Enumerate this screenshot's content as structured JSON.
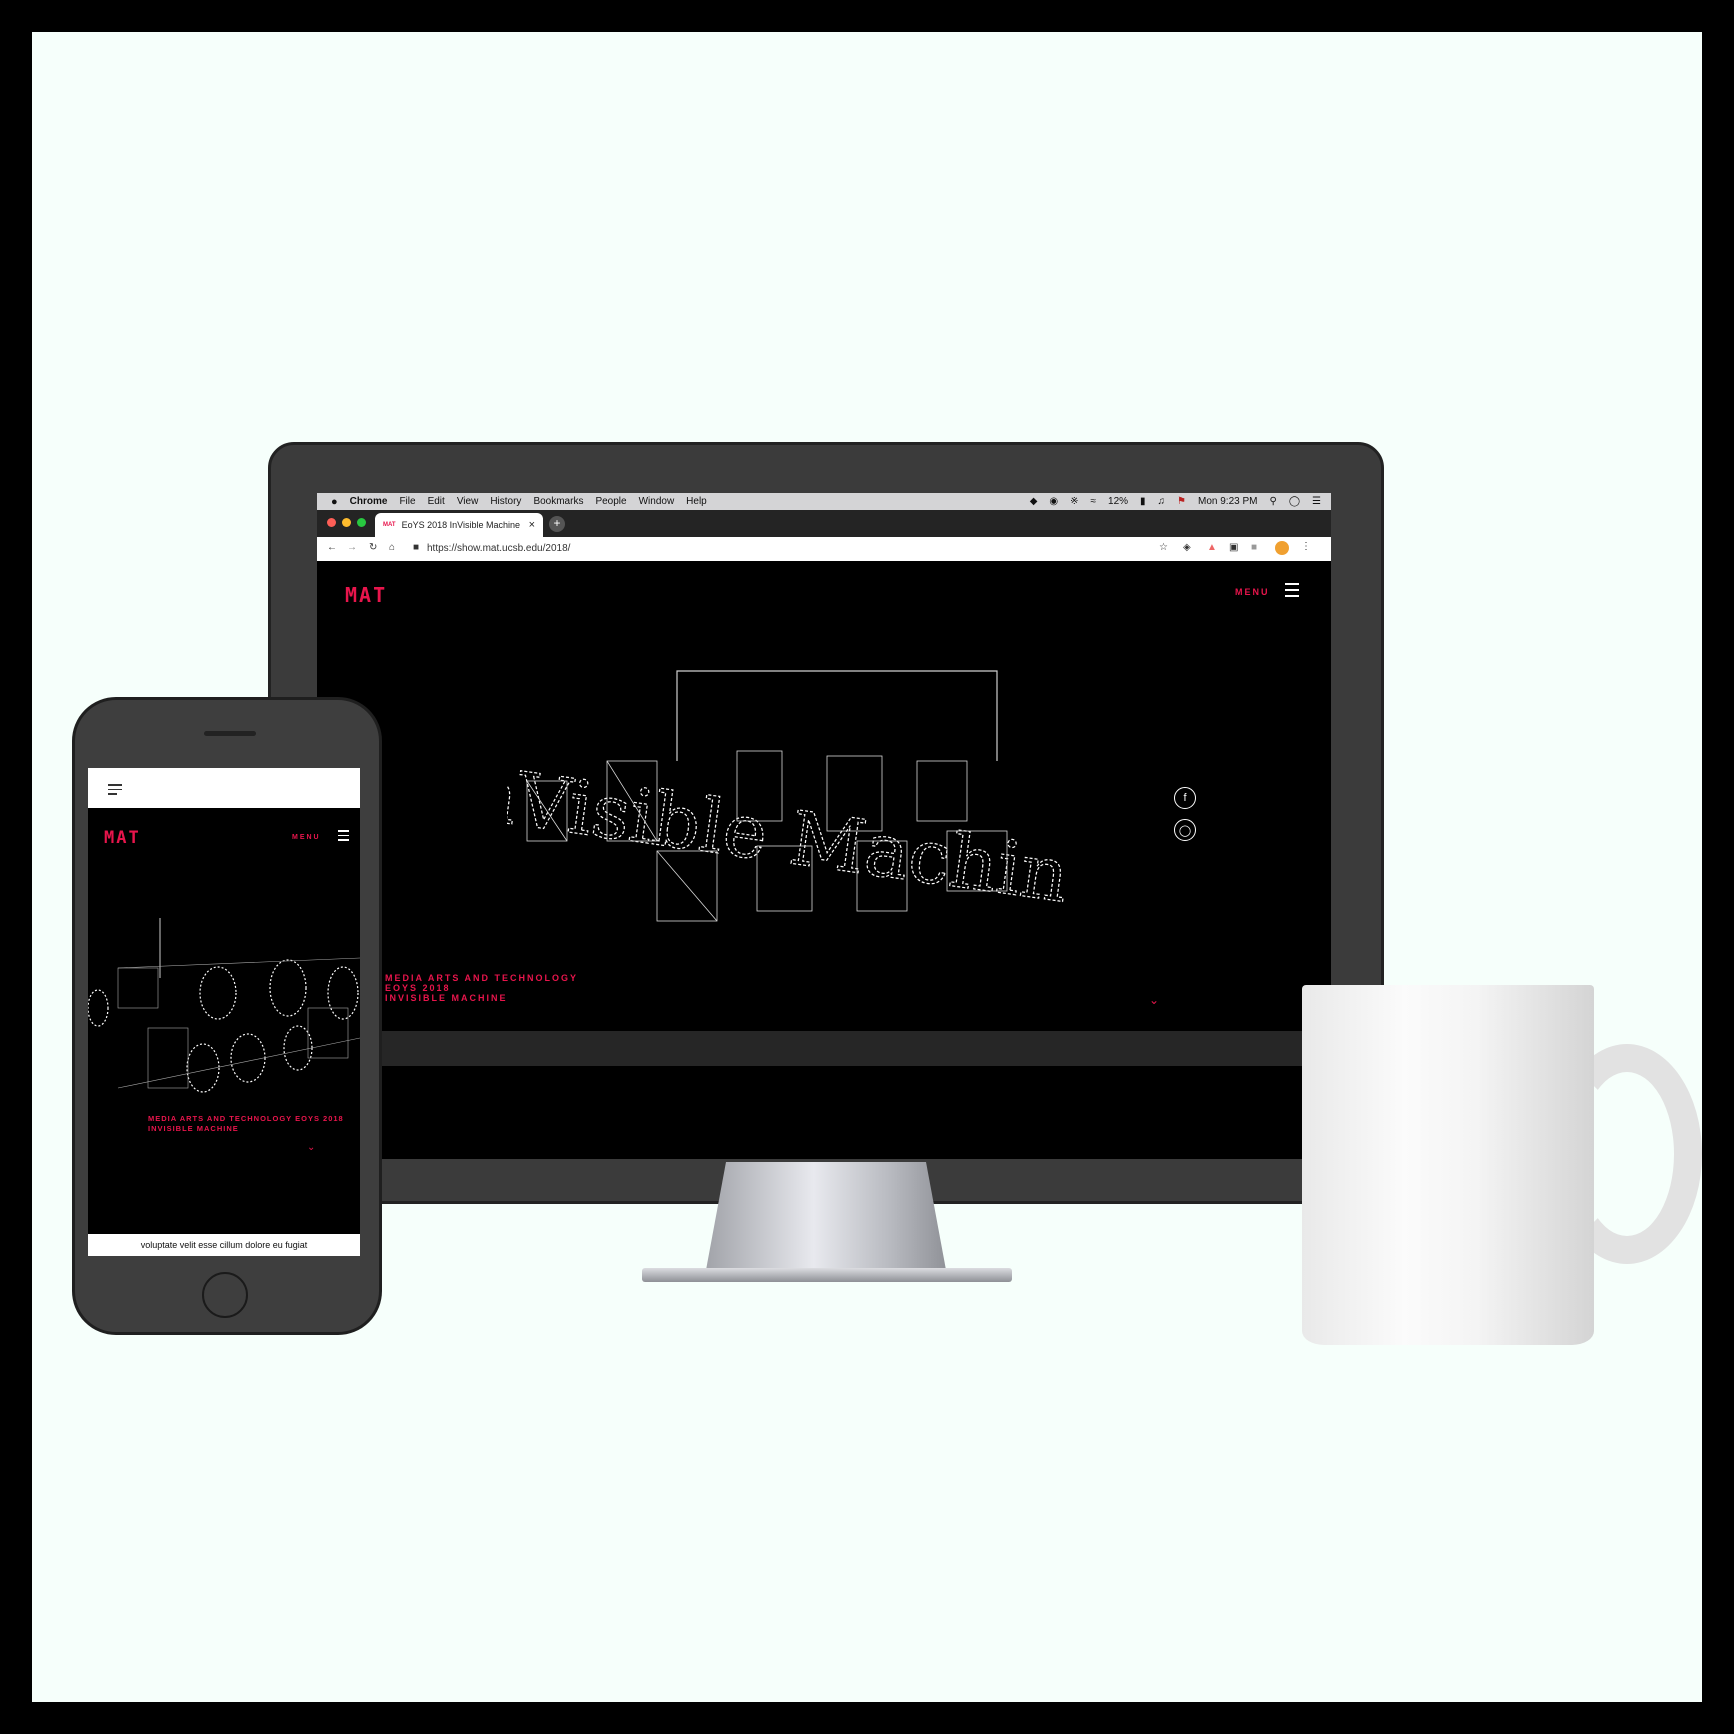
{
  "macos_menu": {
    "apple": "",
    "items": [
      "Chrome",
      "File",
      "Edit",
      "View",
      "History",
      "Bookmarks",
      "People",
      "Window",
      "Help"
    ],
    "battery": "12%",
    "clock": "Mon 9:23 PM"
  },
  "browser": {
    "tab_brand": "MAT",
    "tab_title": "EoYS 2018 InVisible Machine",
    "url": "https://show.mat.ucsb.edu/2018/"
  },
  "site": {
    "logo": "MAT",
    "menu_label": "MENU",
    "hero_lines": [
      "MEDIA ARTS AND TECHNOLOGY",
      "EOYS 2018",
      "INVISIBLE MACHINE"
    ],
    "artwork_text": "InVisible Machine"
  },
  "phone": {
    "logo": "MAT",
    "menu_label": "MENU",
    "hero_text": "MEDIA ARTS AND TECHNOLOGY EOYS 2018 INVISIBLE MACHINE",
    "footer_text": "voluptate velit esse cillum dolore eu fugiat"
  },
  "colors": {
    "accent": "#e8154c",
    "frame": "#000000",
    "background": "#f6fffb"
  }
}
